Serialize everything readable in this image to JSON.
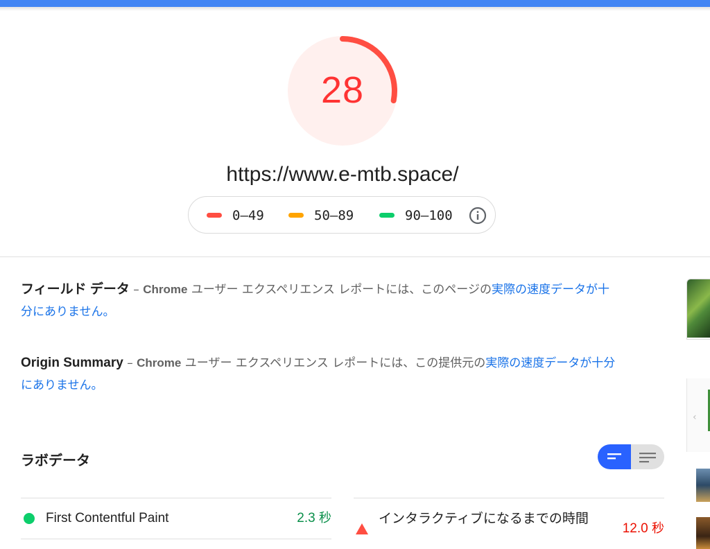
{
  "colors": {
    "accent_bar": "#4285f4",
    "fail": "#ff4e42",
    "average": "#ffa400",
    "pass": "#0cce6b",
    "link": "#1a73e8",
    "toggle_active": "#2962ff"
  },
  "score": {
    "value": "28",
    "fraction": 0.28
  },
  "url": "https://www.e-mtb.space/",
  "legend": {
    "ranges": [
      {
        "label": "0–49"
      },
      {
        "label": "50–89"
      },
      {
        "label": "90–100"
      }
    ],
    "info_icon": "info-icon"
  },
  "field_data": {
    "heading": "フィールド データ",
    "dash": " – ",
    "source": "Chrome",
    "text": " ユーザー エクスペリエンス レポートには、このページの",
    "link": "実際の速度データが十分にありません。"
  },
  "origin_summary": {
    "heading": "Origin Summary",
    "dash": " – ",
    "source": "Chrome",
    "text": " ユーザー エクスペリエンス レポートには、この提供元の",
    "link": "実際の速度データが十分にありません。"
  },
  "lab_data": {
    "title": "ラボデータ",
    "toggle": {
      "active": "compact-view-icon",
      "inactive": "expanded-view-icon"
    },
    "metrics": [
      {
        "name": "First Contentful Paint",
        "value": "2.3",
        "unit": "秒",
        "status": "pass"
      },
      {
        "name": "インタラクティブになるまでの時間",
        "value": "12.0",
        "unit": "秒",
        "status": "fail"
      }
    ]
  }
}
